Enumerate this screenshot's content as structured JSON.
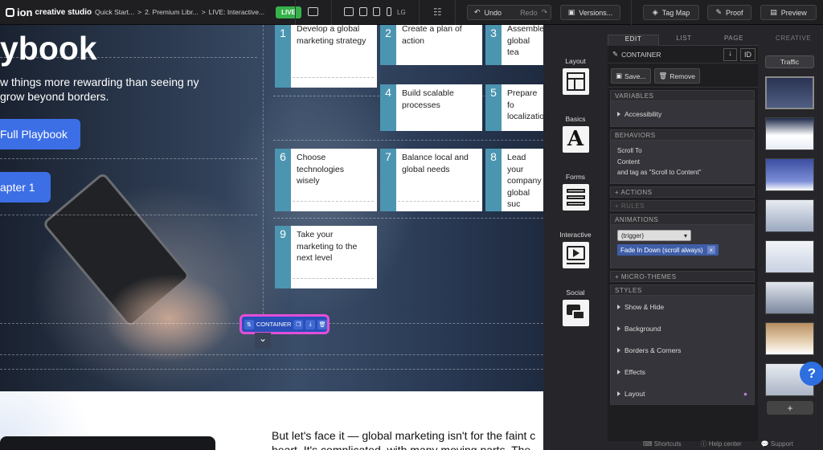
{
  "topbar": {
    "brand": "ion",
    "brand_sub": "creative studio",
    "crumbs": [
      "Quick Start...",
      ">",
      "2. Premium Libr...",
      ">",
      "LIVE: Interactive..."
    ],
    "live_badge": "LIVE",
    "device_lg": "LG",
    "undo": "Undo",
    "redo": "Redo",
    "versions": "Versions...",
    "tag_map": "Tag Map",
    "proof": "Proof",
    "preview": "Preview"
  },
  "canvas": {
    "hero_title": "ybook",
    "hero_sub": "w things more rewarding than seeing ny grow beyond borders.",
    "btn_playbook": "Full Playbook",
    "btn_chapter": "apter 1",
    "cards": [
      {
        "num": "1",
        "text": "Develop a global marketing strategy"
      },
      {
        "num": "2",
        "text": "Create a plan of action"
      },
      {
        "num": "3",
        "text": "Assemble global tea"
      },
      {
        "num": "4",
        "text": "Build scalable processes"
      },
      {
        "num": "5",
        "text": "Prepare fo localizatio"
      },
      {
        "num": "6",
        "text": "Choose technologies wisely"
      },
      {
        "num": "7",
        "text": "Balance local and global needs"
      },
      {
        "num": "8",
        "text": "Lead your company global suc"
      },
      {
        "num": "9",
        "text": "Take your marketing to the next level"
      }
    ],
    "container_tag": "CONTAINER",
    "lower_text": "But let's face it — global marketing isn't for the faint c",
    "lower_text2": "heart. It's complicated, with many moving parts. The"
  },
  "panel": {
    "tabs": [
      "EDIT",
      "LIST",
      "PAGE"
    ],
    "creative": "CREATIVE",
    "left_items": [
      "Layout",
      "Basics",
      "Forms",
      "Interactive",
      "Social"
    ],
    "header": "CONTAINER",
    "id_label": "ID",
    "save": "Save...",
    "remove": "Remove",
    "variables": "VARIABLES",
    "accessibility": "Accessibility",
    "behaviors": "BEHAVIORS",
    "behavior_lines": [
      "Scroll To",
      "Content",
      "and tag as \"Scroll to Content\""
    ],
    "actions": "+ ACTIONS",
    "rules": "+ RULES",
    "animations": "ANIMATIONS",
    "trigger": "(trigger)",
    "animation_chip": "Fade In Down (scroll always)",
    "micro_themes": "+ MICRO-THEMES",
    "styles": "STYLES",
    "style_items": [
      "Show & Hide",
      "Background",
      "Borders & Corners",
      "Effects",
      "Layout"
    ],
    "traffic": "Traffic",
    "add": "+",
    "footer": [
      "Shortcuts",
      "Help center",
      "Support"
    ],
    "help": "?"
  },
  "colors": {
    "live": "#36b24a",
    "accent_blue": "#3c6ee6",
    "card_num": "#4c95b1",
    "selection": "#e24fd8"
  }
}
